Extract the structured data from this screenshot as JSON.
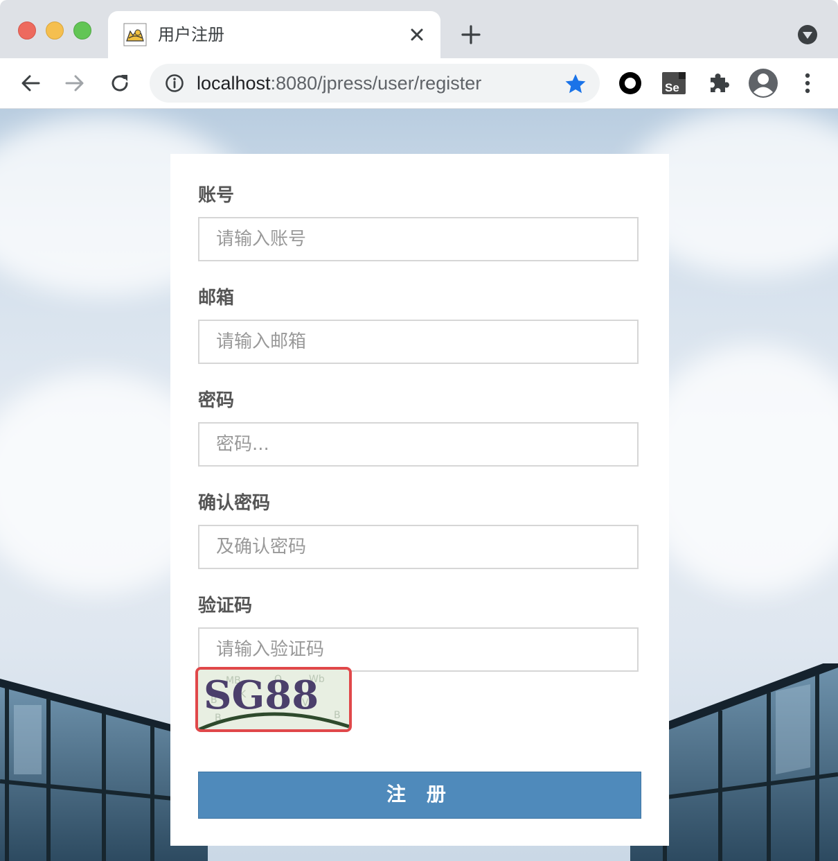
{
  "browser": {
    "tab_title": "用户注册",
    "url_host": "localhost",
    "url_path": ":8080/jpress/user/register"
  },
  "icons": {
    "back": "arrow-left-icon",
    "forward": "arrow-right-icon",
    "reload": "reload-icon",
    "info": "info-icon",
    "bookmark": "star-icon",
    "extensions": [
      "circle-record-icon",
      "selenium-ide-icon",
      "puzzle-extensions-icon"
    ],
    "profile": "profile-avatar-icon",
    "menu": "kebab-menu-icon"
  },
  "form": {
    "account_label": "账号",
    "account_placeholder": "请输入账号",
    "email_label": "邮箱",
    "email_placeholder": "请输入邮箱",
    "password_label": "密码",
    "password_placeholder": "密码...",
    "confirm_label": "确认密码",
    "confirm_placeholder": "及确认密码",
    "captcha_label": "验证码",
    "captcha_placeholder": "请输入验证码",
    "captcha_text": "SG88",
    "submit_label": "注 册"
  },
  "colors": {
    "accent_button": "#4f8abb",
    "captcha_highlight": "#e0484a",
    "bookmark_star": "#1a73e8"
  }
}
